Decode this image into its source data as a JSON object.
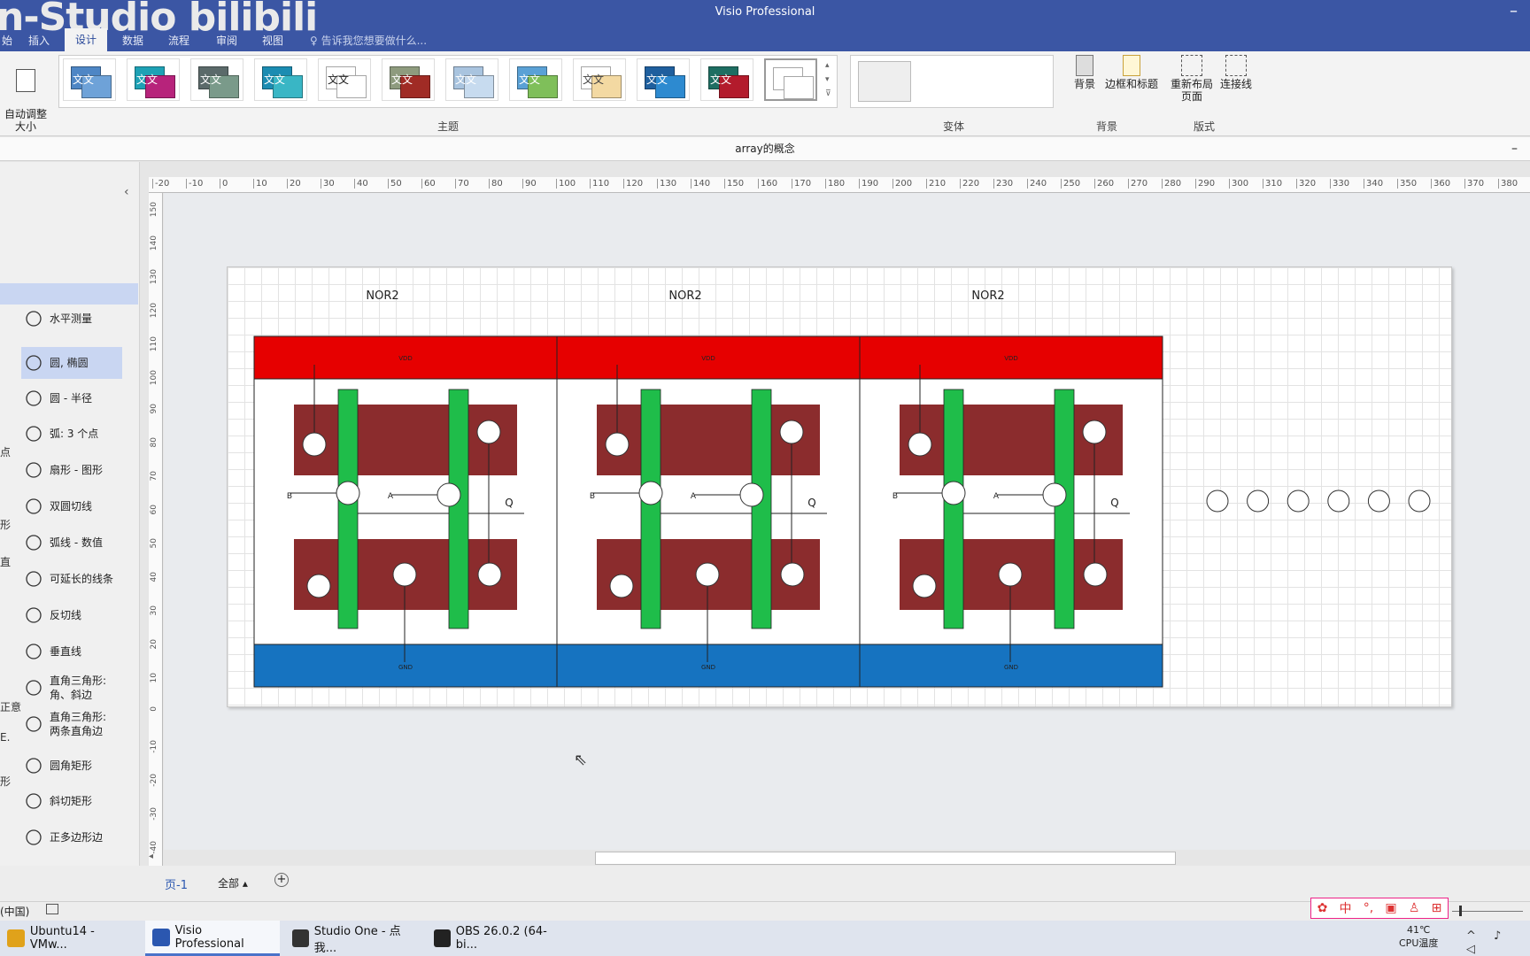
{
  "window": {
    "app_title": "Visio Professional",
    "watermark": "n-Studio bilibili",
    "minimize_glyph": "–"
  },
  "menu": {
    "tabs": [
      "始",
      "插入",
      "设计",
      "数据",
      "流程",
      "审阅",
      "视图"
    ],
    "active_tab": "设计",
    "tell_me": "告诉我您想要做什么..."
  },
  "ribbon": {
    "auto_size": "自动调整\n大小",
    "themes_group": "主题",
    "theme_text": "文文",
    "variants_group": "变体",
    "background_btn": "背景",
    "borders_btn": "边框和标题",
    "background_group": "背景",
    "relayout_btn": "重新布局\n页面",
    "connectors_btn": "连接线",
    "layout_group": "版式"
  },
  "document": {
    "title": "array的概念",
    "minimize_glyph": "–"
  },
  "shapes_panel": {
    "collapse_glyph": "‹",
    "items": [
      {
        "label": "水平测量",
        "icon": "ruler-icon"
      },
      {
        "label": "圆, 椭圆",
        "icon": "circle-icon",
        "selected": true
      },
      {
        "label": "圆 - 半径",
        "icon": "circle-radius-icon"
      },
      {
        "label": "弧: 3 个点",
        "icon": "arc-icon"
      },
      {
        "label": "扇形 - 图形",
        "icon": "sector-icon"
      },
      {
        "label": "双圆切线",
        "icon": "double-circle-icon"
      },
      {
        "label": "弧线 - 数值",
        "icon": "arc-value-icon"
      },
      {
        "label": "可延长的线条",
        "icon": "line-icon"
      },
      {
        "label": "反切线",
        "icon": "reverse-tangent-icon"
      },
      {
        "label": "垂直线",
        "icon": "perpendicular-icon"
      },
      {
        "label": "直角三角形:\n角、斜边",
        "icon": "triangle-icon"
      },
      {
        "label": "直角三角形:\n两条直角边",
        "icon": "triangle-legs-icon"
      },
      {
        "label": "圆角矩形",
        "icon": "rounded-rect-icon"
      },
      {
        "label": "斜切矩形",
        "icon": "bevel-rect-icon"
      },
      {
        "label": "正多边形边",
        "icon": "polygon-icon"
      }
    ],
    "cut_labels": [
      "点",
      "形",
      "直",
      "正意",
      "E.",
      "形"
    ]
  },
  "rulers": {
    "h_ticks": [
      "-20",
      "-10",
      "0",
      "10",
      "20",
      "30",
      "40",
      "50",
      "60",
      "70",
      "80",
      "90",
      "100",
      "110",
      "120",
      "130",
      "140",
      "150",
      "160",
      "170",
      "180",
      "190",
      "200",
      "210",
      "220",
      "230",
      "240",
      "250",
      "260",
      "270",
      "280",
      "290",
      "300",
      "310",
      "320",
      "330",
      "340",
      "350",
      "360",
      "370",
      "380"
    ],
    "v_ticks": [
      "150",
      "140",
      "130",
      "120",
      "110",
      "100",
      "90",
      "80",
      "70",
      "60",
      "50",
      "40",
      "30",
      "20",
      "10",
      "0",
      "-10",
      "-20",
      "-30",
      "-40"
    ]
  },
  "diagram": {
    "cells": [
      {
        "title": "NOR2",
        "vdd": "VDD",
        "gnd": "GND",
        "in_b": "B",
        "in_a": "A",
        "out": "Q"
      },
      {
        "title": "NOR2",
        "vdd": "VDD",
        "gnd": "GND",
        "in_b": "B",
        "in_a": "A",
        "out": "Q"
      },
      {
        "title": "NOR2",
        "vdd": "VDD",
        "gnd": "GND",
        "in_b": "B",
        "in_a": "A",
        "out": "Q"
      }
    ],
    "colors": {
      "vdd": "#e60000",
      "gnd": "#1673c0",
      "diffusion": "#8b2c2d",
      "poly": "#1fbd4a"
    },
    "loose_circles": 6
  },
  "page_tabs": {
    "page": "页-1",
    "all": "全部 ▴",
    "add": "+"
  },
  "status": {
    "language": "(中国)"
  },
  "taskbar": {
    "items": [
      {
        "label": "Ubuntu14 - VMw...",
        "color": "#e0a21b"
      },
      {
        "label": "Visio Professional",
        "color": "#2b57b0",
        "active": true
      },
      {
        "label": "Studio One - 点我...",
        "color": "#333333"
      },
      {
        "label": "OBS 26.0.2 (64-bi...",
        "color": "#222222"
      }
    ],
    "temp": "41℃",
    "temp_label": "CPU温度",
    "ime": "中"
  }
}
